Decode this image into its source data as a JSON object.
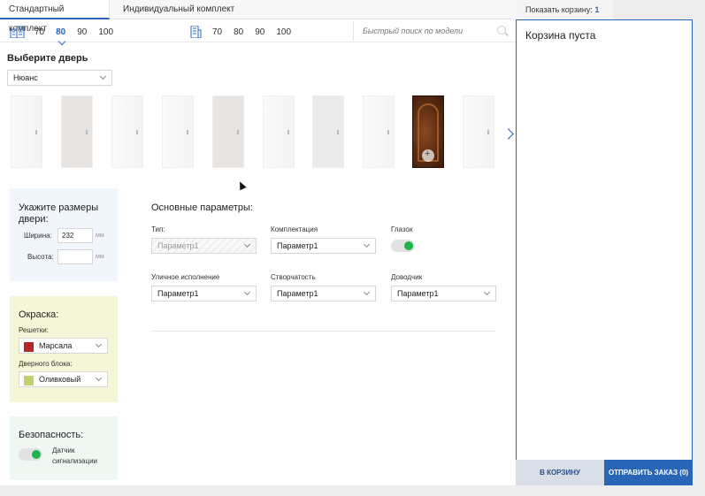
{
  "tabs": [
    {
      "label": "Стандартный комплект",
      "active": true
    },
    {
      "label": "Индивидуальный комплект",
      "active": false
    }
  ],
  "widths_left": {
    "icon": "building-icon",
    "values": [
      "70",
      "80",
      "90",
      "100"
    ],
    "selected": "80"
  },
  "widths_right": {
    "icon": "building-tall-icon",
    "values": [
      "70",
      "80",
      "90",
      "100"
    ]
  },
  "search": {
    "placeholder": "Быстрый поиск по модели"
  },
  "door_select": {
    "title": "Выберите дверь",
    "value": "Нюанс"
  },
  "door_gallery": {
    "count": 10,
    "selected_index": 8
  },
  "sizes": {
    "title": "Укажите размеры двери:",
    "width_label": "Ширина:",
    "width_value": "232",
    "height_label": "Высота:",
    "height_value": "",
    "unit": "мм"
  },
  "paint": {
    "title": "Окраска:",
    "grille_label": "Решетки:",
    "grille_value": "Марсала",
    "grille_color": "#b5262b",
    "block_label": "Дверного блока:",
    "block_value": "Оливковый",
    "block_color": "#c3cf6b"
  },
  "security": {
    "title": "Безопасность:",
    "sensor_label": "Датчик сигнализации",
    "sensor_on": true
  },
  "params": {
    "title": "Основные параметры:",
    "type_label": "Тип:",
    "type_value": "Параметр1",
    "kit_label": "Комплектация",
    "kit_value": "Параметр1",
    "peephole_label": "Глазок",
    "peephole_on": true,
    "street_label": "Уличное исполнение",
    "street_value": "Параметр1",
    "leaf_label": "Створчатость",
    "leaf_value": "Параметр1",
    "closer_label": "Доводчик",
    "closer_value": "Параметр1"
  },
  "cart": {
    "tab_label": "Показать корзину:",
    "tab_count": "1",
    "empty_text": "Корзина пуста",
    "add_button": "В КОРЗИНУ",
    "send_button": "ОТПРАВИТЬ ЗАКАЗ (0)"
  },
  "colors": {
    "accent": "#2a66b8",
    "toggle_on": "#1fb34a"
  }
}
